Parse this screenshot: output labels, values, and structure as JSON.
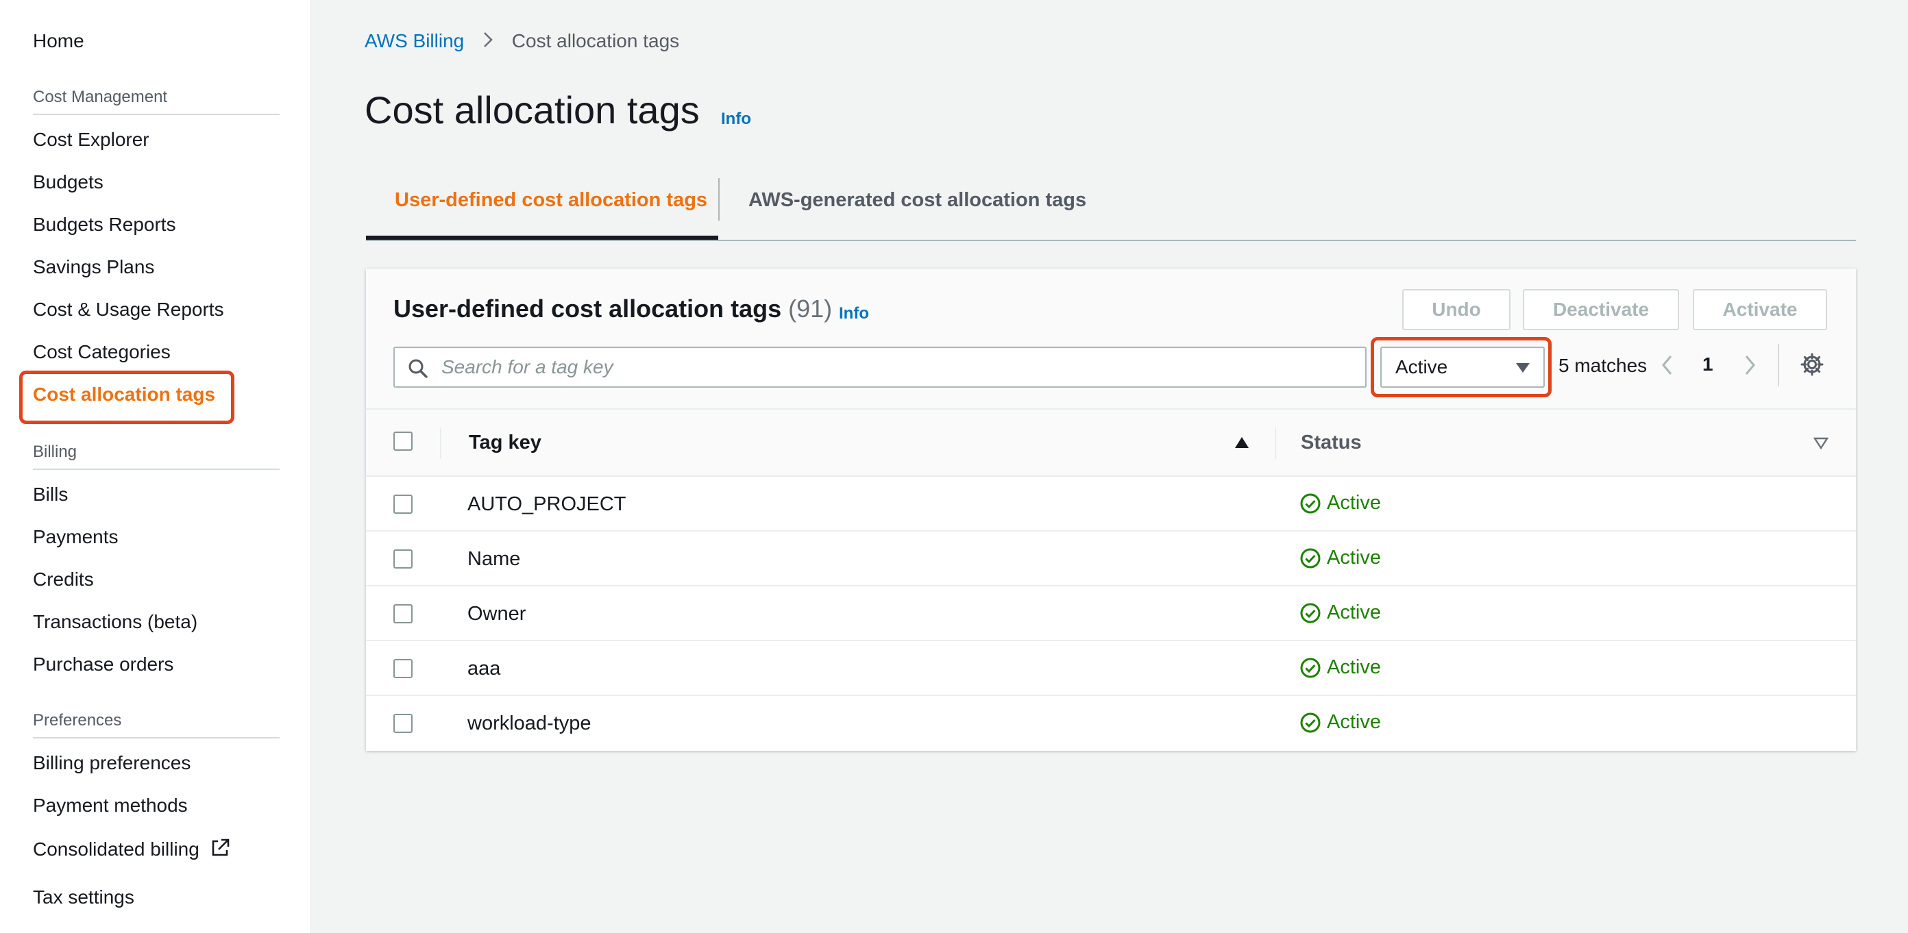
{
  "sidebar": {
    "home": "Home",
    "sections": [
      {
        "title": "Cost Management"
      },
      {
        "title": "Billing"
      },
      {
        "title": "Preferences"
      }
    ],
    "cost_management_items": [
      "Cost Explorer",
      "Budgets",
      "Budgets Reports",
      "Savings Plans",
      "Cost & Usage Reports",
      "Cost Categories",
      "Cost allocation tags"
    ],
    "billing_items": [
      "Bills",
      "Payments",
      "Credits",
      "Transactions (beta)",
      "Purchase orders"
    ],
    "preferences_items": [
      "Billing preferences",
      "Payment methods",
      "Consolidated billing"
    ],
    "tax_settings": "Tax settings",
    "active_item": "Cost allocation tags"
  },
  "breadcrumb": {
    "root": "AWS Billing",
    "current": "Cost allocation tags"
  },
  "page": {
    "title": "Cost allocation tags",
    "info": "Info"
  },
  "tabs": [
    {
      "label": "User-defined cost allocation tags",
      "active": true
    },
    {
      "label": "AWS-generated cost allocation tags",
      "active": false
    }
  ],
  "panel": {
    "title": "User-defined cost allocation tags",
    "count": "(91)",
    "info": "Info",
    "buttons": {
      "undo": "Undo",
      "deactivate": "Deactivate",
      "activate": "Activate"
    },
    "search_placeholder": "Search for a tag key",
    "filter_value": "Active",
    "matches": "5 matches",
    "page": "1"
  },
  "table": {
    "columns": [
      "Tag key",
      "Status"
    ],
    "rows": [
      {
        "key": "AUTO_PROJECT",
        "status": "Active"
      },
      {
        "key": "Name",
        "status": "Active"
      },
      {
        "key": "Owner",
        "status": "Active"
      },
      {
        "key": "aaa",
        "status": "Active"
      },
      {
        "key": "workload-type",
        "status": "Active"
      }
    ]
  },
  "colors": {
    "accent_orange": "#ec7211",
    "link_blue": "#0073bb",
    "success_green": "#1d8102",
    "highlight_red": "#e0441d"
  }
}
